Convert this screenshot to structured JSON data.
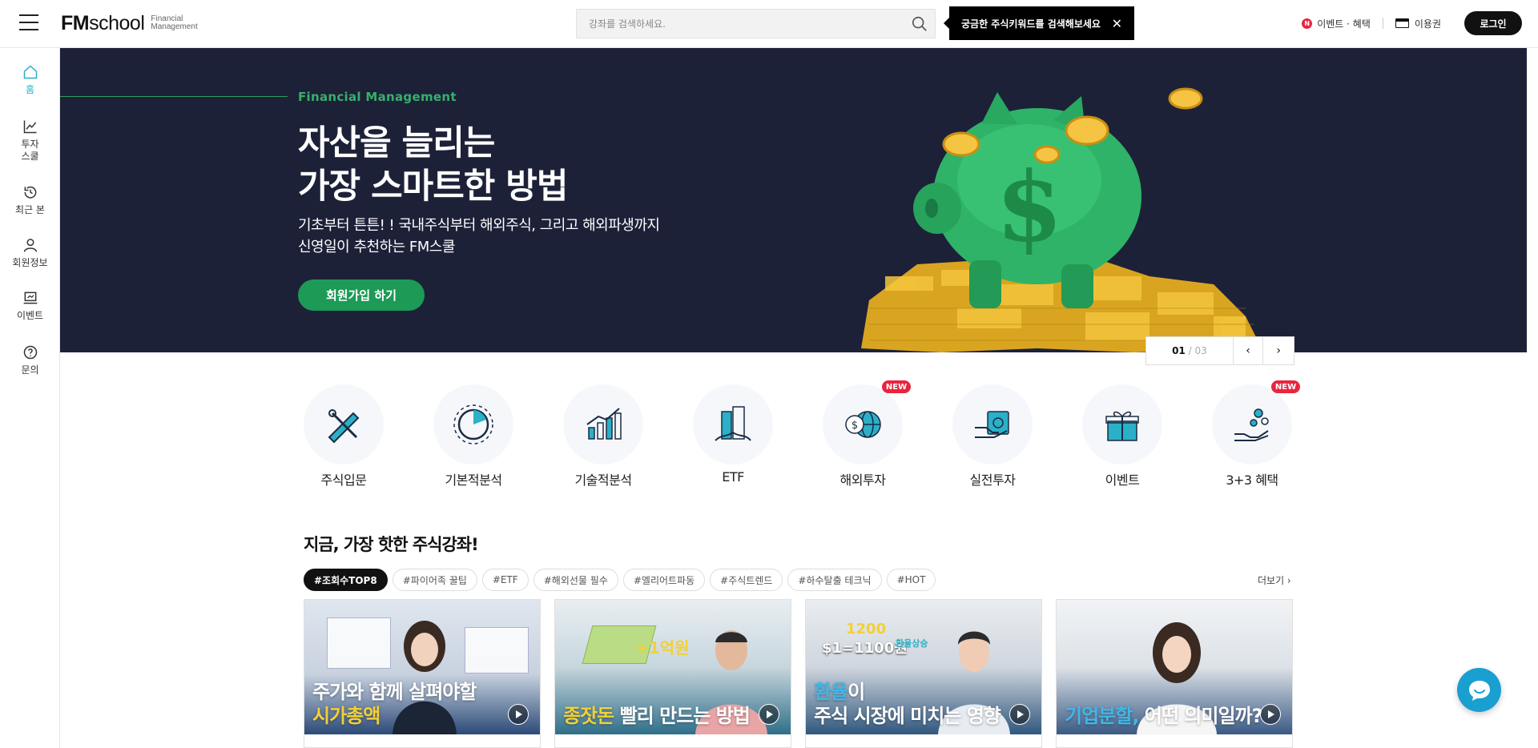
{
  "header": {
    "logo_main_bold": "FM",
    "logo_main": "school",
    "logo_sub_1": "Financial",
    "logo_sub_2": "Management",
    "search_placeholder": "강좌를 검색하세요.",
    "tooltip_text": "궁금한 주식키워드를 검색해보세요",
    "tooltip_close": "✕",
    "event_badge": "N",
    "event_label": "이벤트 · 혜택",
    "ticket_label": "이용권",
    "login_label": "로그인"
  },
  "sidebar": {
    "items": [
      {
        "label": "홈",
        "icon": "home-icon"
      },
      {
        "label": "투자\n스쿨",
        "icon": "chart-icon"
      },
      {
        "label": "최근 본",
        "icon": "history-icon"
      },
      {
        "label": "회원정보",
        "icon": "user-icon"
      },
      {
        "label": "이벤트",
        "icon": "event-icon"
      },
      {
        "label": "문의",
        "icon": "help-icon"
      }
    ]
  },
  "banner": {
    "subtitle": "Financial Management",
    "title_1": "자산을 늘리는",
    "title_2": "가장 스마트한 방법",
    "desc_1": "기초부터 튼튼! ! 국내주식부터 해외주식, 그리고 해외파생까지",
    "desc_2": "신영일이 추천하는 FM스쿨",
    "cta": "회원가입 하기",
    "page_current": "01",
    "page_sep": "/",
    "page_total": "03",
    "prev": "‹",
    "next": "›"
  },
  "categories": [
    {
      "label": "주식입문",
      "icon": "pen-ruler-icon",
      "new": false
    },
    {
      "label": "기본적분석",
      "icon": "pie-analysis-icon",
      "new": false
    },
    {
      "label": "기술적분석",
      "icon": "bar-chart-icon",
      "new": false
    },
    {
      "label": "ETF",
      "icon": "buildings-icon",
      "new": false
    },
    {
      "label": "해외투자",
      "icon": "globe-dollar-icon",
      "new": true
    },
    {
      "label": "실전투자",
      "icon": "cash-hand-icon",
      "new": false
    },
    {
      "label": "이벤트",
      "icon": "gift-icon",
      "new": false
    },
    {
      "label": "3+3 혜택",
      "icon": "coins-hand-icon",
      "new": true
    }
  ],
  "new_badge": "NEW",
  "section": {
    "title": "지금, 가장 핫한 주식강좌!",
    "more": "더보기 ›",
    "tags": [
      "#조회수TOP8",
      "#파이어족 꿀팁",
      "#ETF",
      "#해외선물 필수",
      "#엘리어트파동",
      "#주식트렌드",
      "#하수탈출 테크닉",
      "#HOT"
    ]
  },
  "cards": [
    {
      "line1": "주가와 함께 살펴야할",
      "line2_hl": "시가총액",
      "line2": ""
    },
    {
      "line1": "",
      "line2_hl": "종잣돈",
      "line2": " 빨리 만드는 방법",
      "overlay": "+1억원"
    },
    {
      "line1_hl": "환율",
      "line1": "이",
      "line2": "주식 시장에 미치는 영향",
      "overlay": "$1=1100원",
      "overlay2": "1200",
      "overlay3": "환율상승"
    },
    {
      "line1": "",
      "line2_hl": "기업분할,",
      "line2": " 어떤 의미일까?"
    }
  ],
  "colors": {
    "banner_bg": "#1d2138",
    "accent_green": "#1d9a56",
    "sidebar_active": "#2ab0c8",
    "new_red": "#e8263f",
    "chat_blue": "#1a9fd1"
  }
}
